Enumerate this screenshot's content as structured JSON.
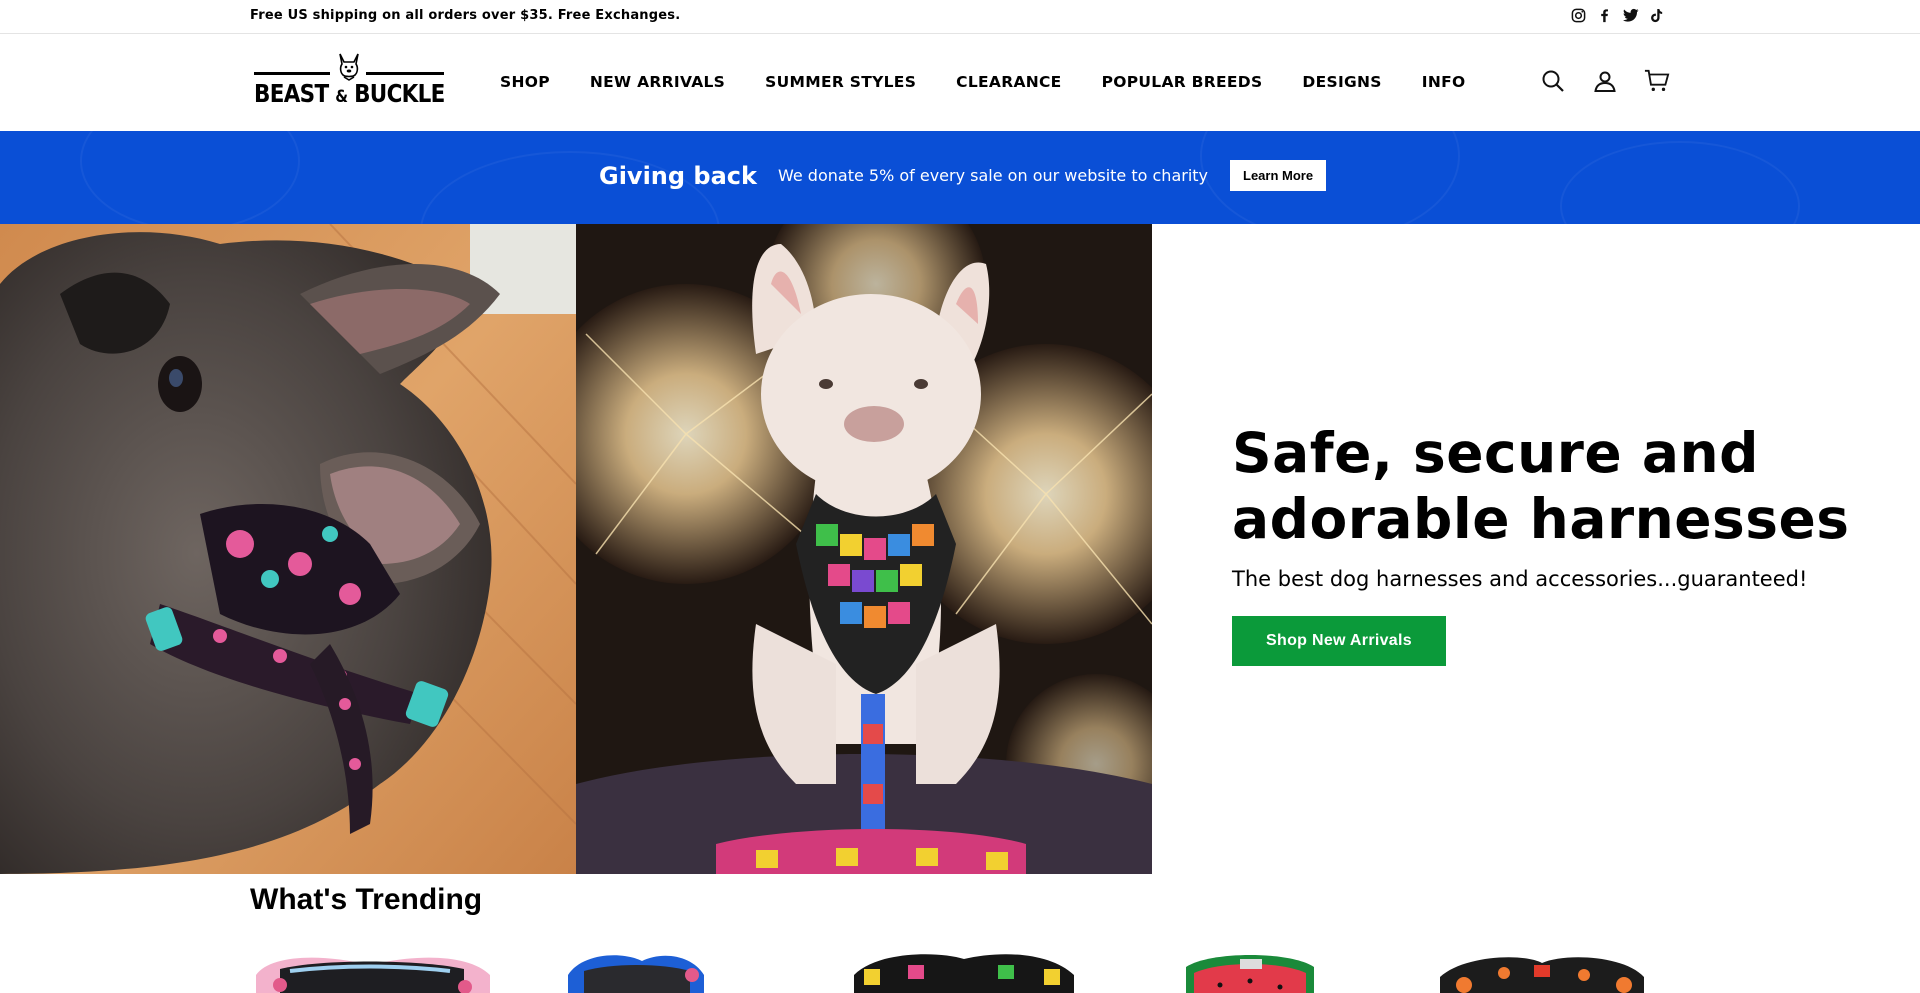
{
  "announcement": {
    "text": "Free US shipping on all orders over $35. Free Exchanges."
  },
  "social": [
    "instagram-icon",
    "facebook-icon",
    "twitter-icon",
    "tiktok-icon"
  ],
  "logo": {
    "line1": "BEAST",
    "amp": "&",
    "line2": "BUCKLE"
  },
  "nav": {
    "items": [
      "SHOP",
      "NEW ARRIVALS",
      "SUMMER STYLES",
      "CLEARANCE",
      "POPULAR BREEDS",
      "DESIGNS",
      "INFO"
    ]
  },
  "header_icons": [
    "search-icon",
    "account-icon",
    "cart-icon"
  ],
  "giving": {
    "title": "Giving back",
    "text": "We donate 5% of every sale on our website to charity",
    "button": "Learn More"
  },
  "hero": {
    "title_line1": "Safe, secure and",
    "title_line2": "adorable harnesses",
    "subtitle": "The best dog harnesses and accessories...guaranteed!",
    "button": "Shop New Arrivals"
  },
  "trending": {
    "title": "What's Trending"
  },
  "colors": {
    "banner": "#0a4fd6",
    "cta": "#0b9a3a"
  }
}
